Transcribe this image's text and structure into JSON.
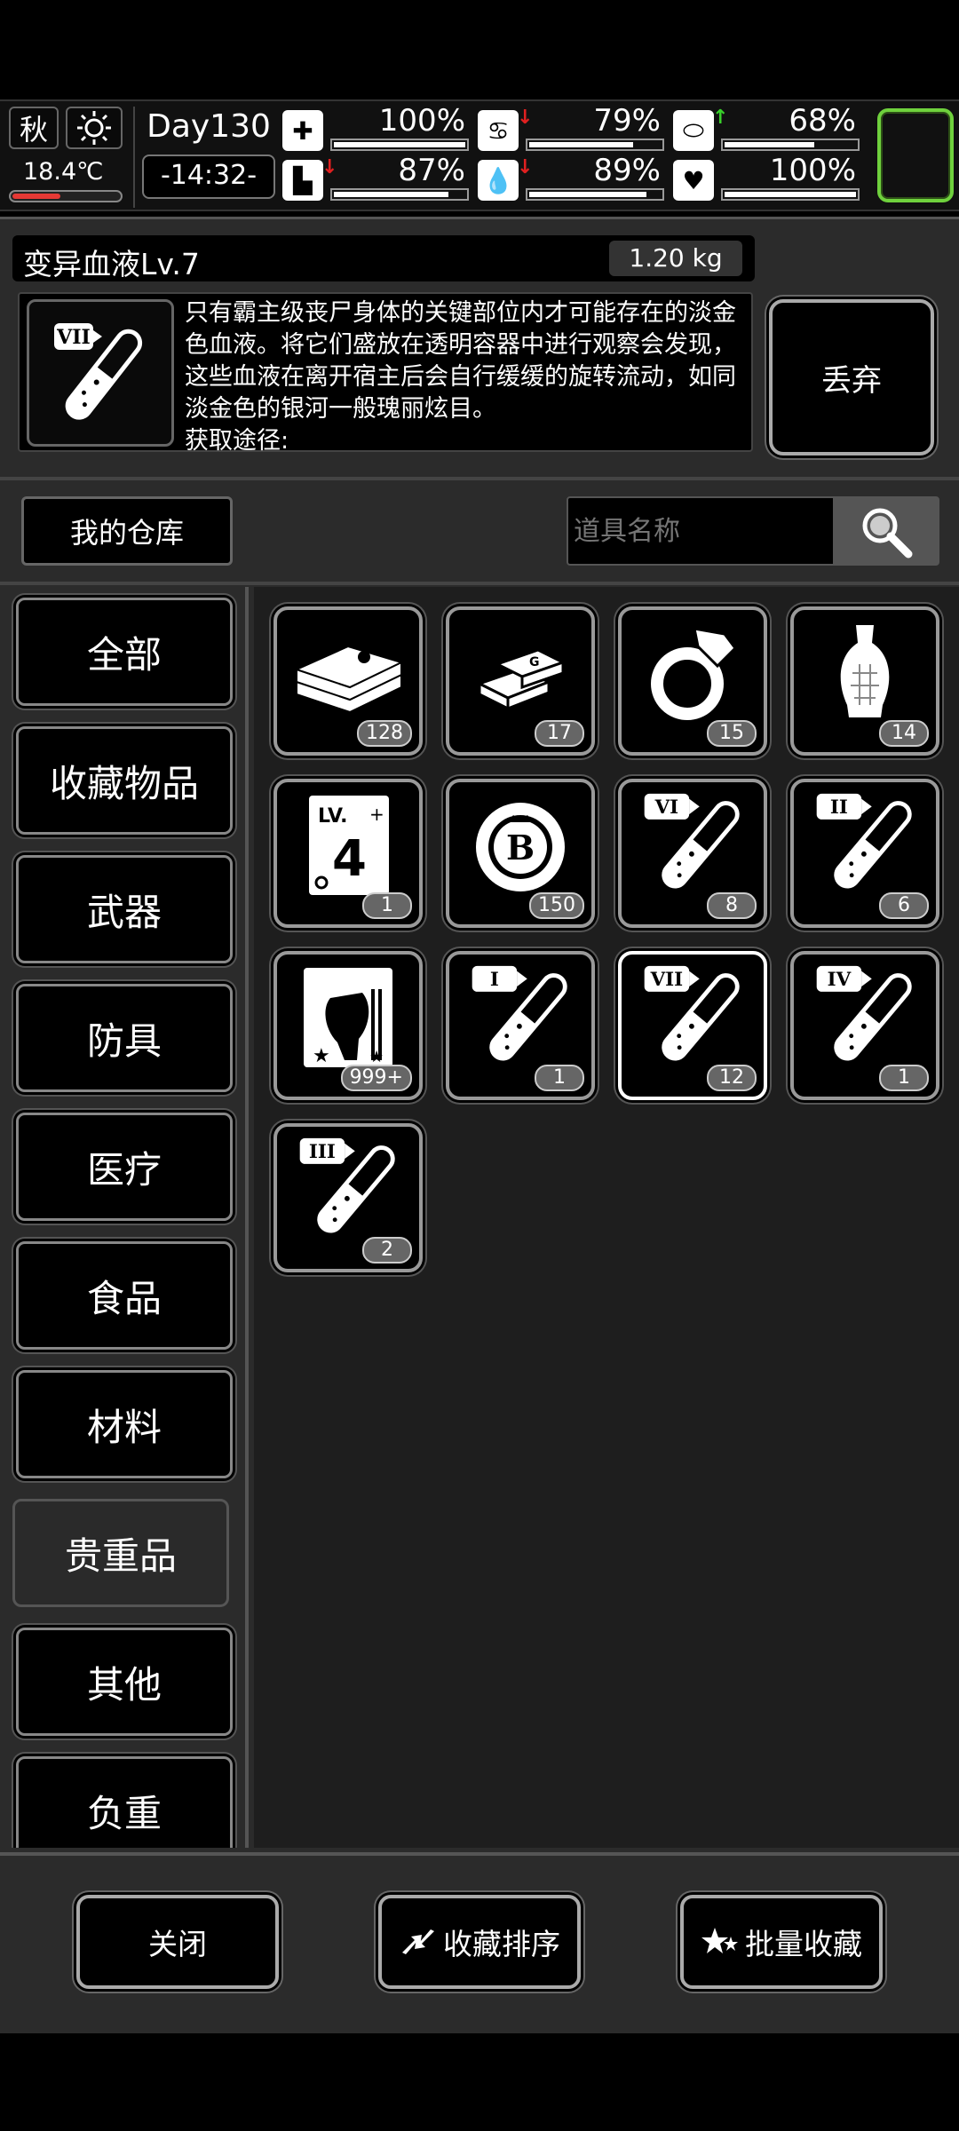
{
  "status": {
    "season": "秋",
    "temperature": "18.4℃",
    "temperature_level": 0.45,
    "day": "Day130",
    "clock": "-14:32-",
    "stats": [
      {
        "icon": "medkit-icon",
        "value": "100%",
        "level": 1.0,
        "trend": ""
      },
      {
        "icon": "stomach-icon",
        "value": "79%",
        "level": 0.79,
        "trend": "down"
      },
      {
        "icon": "pill-icon",
        "value": "68%",
        "level": 0.68,
        "trend": "up"
      },
      {
        "icon": "boot-icon",
        "value": "87%",
        "level": 0.87,
        "trend": "down"
      },
      {
        "icon": "water-drop-icon",
        "value": "89%",
        "level": 0.89,
        "trend": "down"
      },
      {
        "icon": "heart-icon",
        "value": "100%",
        "level": 1.0,
        "trend": ""
      }
    ],
    "colors": {
      "up": "#39d12b",
      "down": "#e02020",
      "temp_fill": "#e53935",
      "slot_border": "#6fd13d"
    }
  },
  "detail": {
    "title": "变异血液Lv.7",
    "weight": "1.20 kg",
    "icon_numeral": "VII",
    "description": "只有霸主级丧尸身体的关键部位内才可能存在的淡金色血液。将它们盛放在透明容器中进行观察会发现，这些血液在离开宿主后会自行缓缓的旋转流动，如同淡金色的银河一般瑰丽炫目。",
    "source_label": "获取途径:",
    "discard_label": "丢弃"
  },
  "storage": {
    "tab_label": "我的仓库",
    "search_placeholder": "道具名称"
  },
  "categories": [
    {
      "label": "全部"
    },
    {
      "label": "收藏物品"
    },
    {
      "label": "武器"
    },
    {
      "label": "防具"
    },
    {
      "label": "医疗"
    },
    {
      "label": "食品"
    },
    {
      "label": "材料"
    },
    {
      "label": "贵重品",
      "active": true
    },
    {
      "label": "其他"
    },
    {
      "label": "负重"
    }
  ],
  "items": [
    {
      "name": "cash-stack-icon",
      "count": "128"
    },
    {
      "name": "gold-bars-icon",
      "count": "17"
    },
    {
      "name": "diamond-ring-icon",
      "count": "15"
    },
    {
      "name": "vase-icon",
      "count": "14"
    },
    {
      "name": "lv4-card-icon",
      "count": "1",
      "text": "LV. 4"
    },
    {
      "name": "b-coin-icon",
      "count": "150"
    },
    {
      "name": "blood-vial-vi-icon",
      "count": "8",
      "numeral": "VI"
    },
    {
      "name": "blood-vial-ii-icon",
      "count": "6",
      "numeral": "II"
    },
    {
      "name": "zombie-card-icon",
      "count": "999+"
    },
    {
      "name": "blood-vial-i-icon",
      "count": "1",
      "numeral": "I"
    },
    {
      "name": "blood-vial-vii-icon",
      "count": "12",
      "numeral": "VII",
      "selected": true
    },
    {
      "name": "blood-vial-iv-icon",
      "count": "1",
      "numeral": "IV"
    },
    {
      "name": "blood-vial-iii-icon",
      "count": "2",
      "numeral": "III"
    }
  ],
  "bottom": {
    "close_label": "关闭",
    "sort_label": "收藏排序",
    "batch_label": "批量收藏"
  }
}
